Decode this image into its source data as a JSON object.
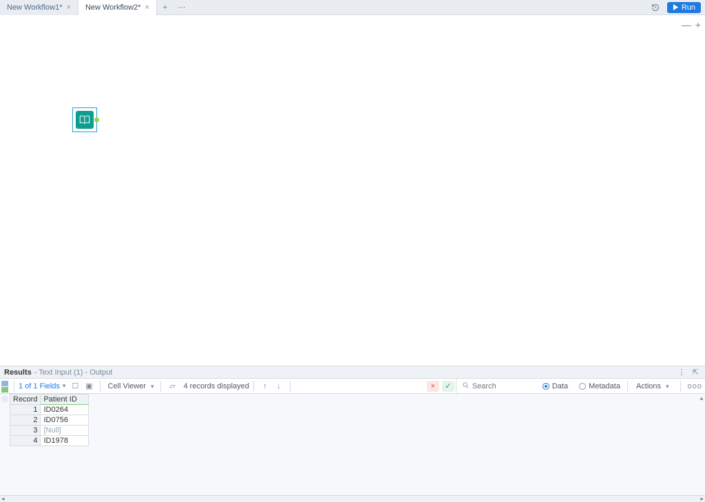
{
  "tabs": [
    {
      "label": "New Workflow1*",
      "active": false
    },
    {
      "label": "New Workflow2*",
      "active": true
    }
  ],
  "run_label": "Run",
  "results": {
    "title": "Results",
    "subtitle": "- Text Input (1) - Output"
  },
  "toolbar": {
    "fields_label": "1 of 1 Fields",
    "cell_viewer_label": "Cell Viewer",
    "records_label": "4 records displayed",
    "search_placeholder": "Search",
    "radio_data": "Data",
    "radio_meta": "Metadata",
    "actions_label": "Actions",
    "meatballs": "ooo"
  },
  "grid": {
    "headers": {
      "record": "Record",
      "col1": "Patient ID"
    },
    "rows": [
      {
        "n": "1",
        "v": "ID0264",
        "null": false
      },
      {
        "n": "2",
        "v": "ID0756",
        "null": false
      },
      {
        "n": "3",
        "v": "[Null]",
        "null": true
      },
      {
        "n": "4",
        "v": "ID1978",
        "null": false
      }
    ]
  }
}
